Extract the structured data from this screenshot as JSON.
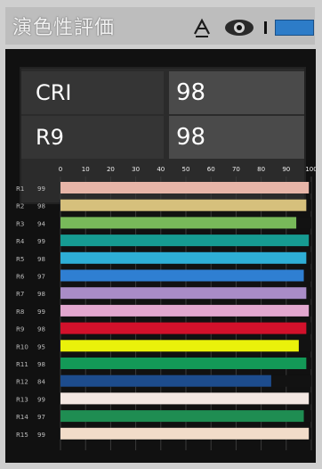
{
  "header": {
    "title": "演色性評価",
    "icons": {
      "a": "a-icon",
      "eye": "eye-icon",
      "signal": "signal-icon",
      "battery": "battery-icon"
    }
  },
  "metrics": [
    {
      "label": "CRI",
      "value": "98"
    },
    {
      "label": "R9",
      "value": "98"
    }
  ],
  "chart_data": {
    "type": "bar",
    "title": "",
    "xlabel": "",
    "ylabel": "",
    "xlim": [
      0,
      100
    ],
    "x_ticks": [
      0,
      10,
      20,
      30,
      40,
      50,
      60,
      70,
      80,
      90,
      100
    ],
    "rows": [
      {
        "name": "R1",
        "value": 99,
        "color": "#e7b5a8",
        "label_color": "#bdbdbd"
      },
      {
        "name": "R2",
        "value": 98,
        "color": "#d6c07c",
        "label_color": "#bdbdbd"
      },
      {
        "name": "R3",
        "value": 94,
        "color": "#78b95a",
        "label_color": "#bdbdbd"
      },
      {
        "name": "R4",
        "value": 99,
        "color": "#169b92",
        "label_color": "#bdbdbd"
      },
      {
        "name": "R5",
        "value": 98,
        "color": "#2eaed6",
        "label_color": "#bdbdbd"
      },
      {
        "name": "R6",
        "value": 97,
        "color": "#2f7fd2",
        "label_color": "#bdbdbd"
      },
      {
        "name": "R7",
        "value": 98,
        "color": "#a98cc7",
        "label_color": "#bdbdbd"
      },
      {
        "name": "R8",
        "value": 99,
        "color": "#e2a7cf",
        "label_color": "#bdbdbd"
      },
      {
        "name": "R9",
        "value": 98,
        "color": "#d2112b",
        "label_color": "#c43333"
      },
      {
        "name": "R10",
        "value": 95,
        "color": "#eaf10b",
        "label_color": "#bdbdbd"
      },
      {
        "name": "R11",
        "value": 98,
        "color": "#139957",
        "label_color": "#2aa35b"
      },
      {
        "name": "R12",
        "value": 84,
        "color": "#1d4c8d",
        "label_color": "#bdbdbd"
      },
      {
        "name": "R13",
        "value": 99,
        "color": "#f3e7e2",
        "label_color": "#bdbdbd"
      },
      {
        "name": "R14",
        "value": 97,
        "color": "#1f8d52",
        "label_color": "#2aa35b"
      },
      {
        "name": "R15",
        "value": 99,
        "color": "#f2dcc9",
        "label_color": "#bdbdbd"
      }
    ]
  }
}
